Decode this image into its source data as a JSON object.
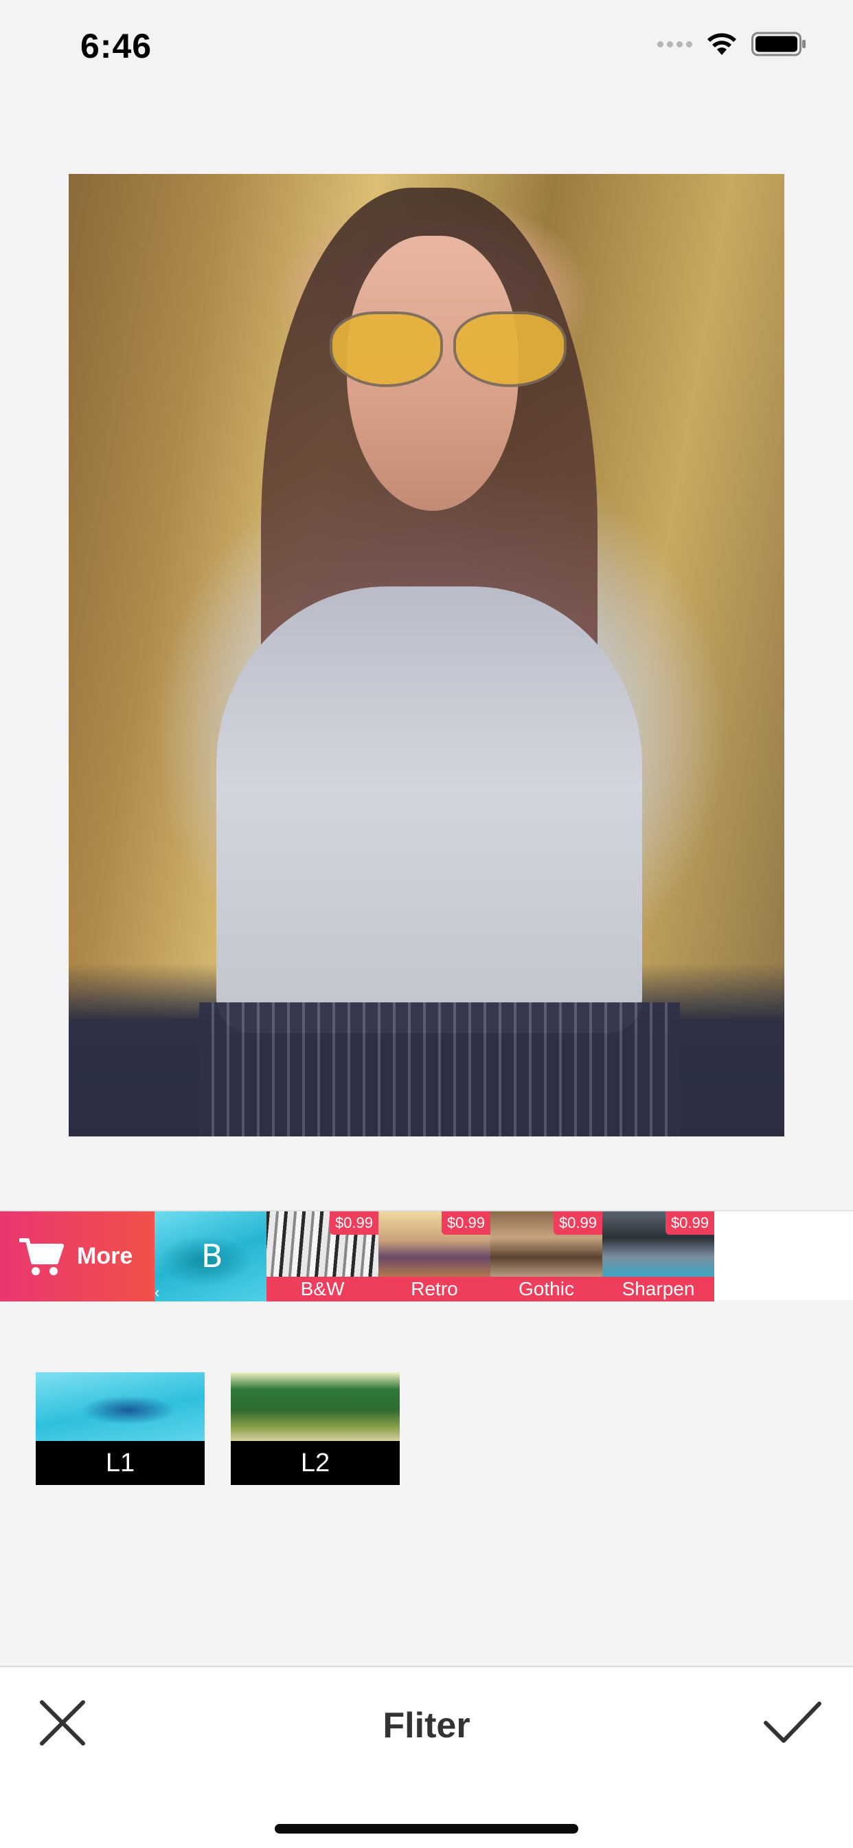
{
  "status_bar": {
    "time": "6:46"
  },
  "filter_strip": {
    "more_label": "More",
    "b_thumb_letter": "B",
    "paid_filters": [
      {
        "label": "B&W",
        "price": "$0.99"
      },
      {
        "label": "Retro",
        "price": "$0.99"
      },
      {
        "label": "Gothic",
        "price": "$0.99"
      },
      {
        "label": "Sharpen",
        "price": "$0.99"
      }
    ]
  },
  "sub_filters": [
    {
      "label": "L1"
    },
    {
      "label": "L2"
    }
  ],
  "bottom_bar": {
    "title": "Fliter"
  },
  "colors": {
    "accent": "#ef3e5b",
    "more_gradient_start": "#ea3770",
    "more_gradient_end": "#f0514a"
  }
}
